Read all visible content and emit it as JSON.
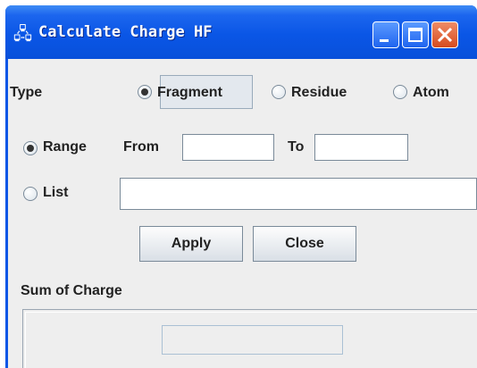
{
  "window": {
    "title": "Calculate Charge HF",
    "app_icon": "molecule-icon",
    "controls": [
      "minimize-icon",
      "maximize-icon",
      "close-icon"
    ]
  },
  "type_row": {
    "label": "Type",
    "options": [
      {
        "label": "Fragment",
        "checked": true
      },
      {
        "label": "Residue",
        "checked": false
      },
      {
        "label": "Atom",
        "checked": false
      }
    ]
  },
  "range_row": {
    "label": "Range",
    "checked": true,
    "from_label": "From",
    "from_value": "",
    "to_label": "To",
    "to_value": ""
  },
  "list_row": {
    "label": "List",
    "checked": false,
    "value": ""
  },
  "buttons": {
    "apply": "Apply",
    "close": "Close"
  },
  "sum": {
    "label": "Sum of Charge",
    "value": ""
  }
}
